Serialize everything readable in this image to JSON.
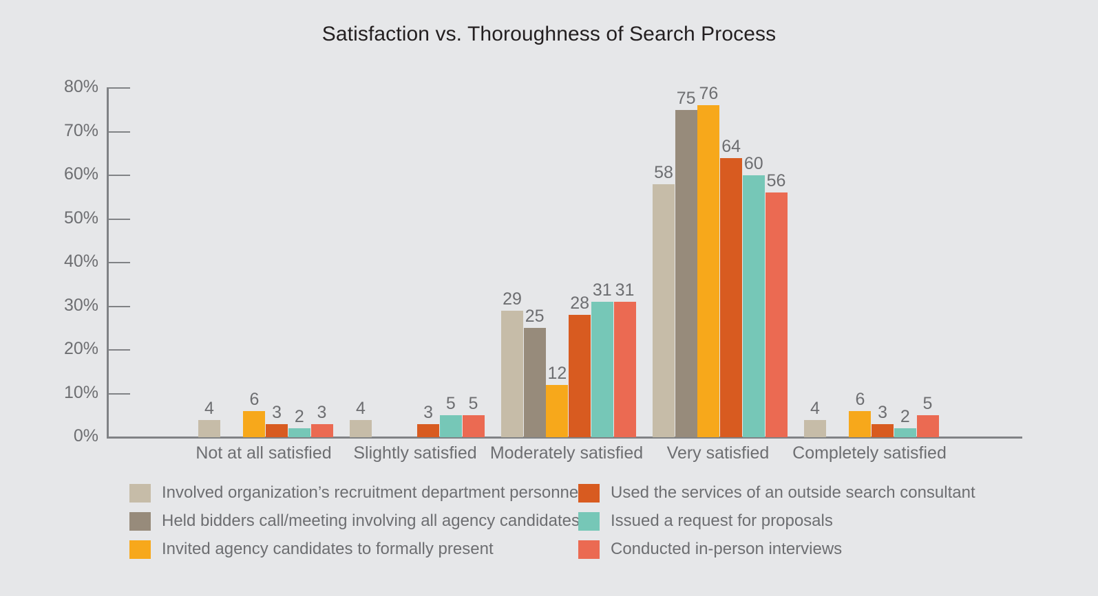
{
  "chart_data": {
    "type": "bar",
    "title": "Satisfaction vs. Thoroughness of Search Process",
    "xlabel": "",
    "ylabel": "",
    "ylim": [
      0,
      80
    ],
    "ytick_labels": [
      "0%",
      "10%",
      "20%",
      "30%",
      "40%",
      "50%",
      "60%",
      "70%",
      "80%"
    ],
    "ytick_values": [
      0,
      10,
      20,
      30,
      40,
      50,
      60,
      70,
      80
    ],
    "grid": false,
    "legend_position": "bottom",
    "value_labels": true,
    "categories": [
      "Not at all satisfied",
      "Slightly satisfied",
      "Moderately satisfied",
      "Very satisfied",
      "Completely satisfied"
    ],
    "series": [
      {
        "name": "Involved organization’s recruitment department personnel",
        "color": "#c6bca8",
        "values": [
          4,
          4,
          29,
          58,
          4
        ]
      },
      {
        "name": "Held bidders call/meeting involving all agency candidates",
        "color": "#978b7b",
        "values": [
          null,
          null,
          25,
          75,
          null
        ]
      },
      {
        "name": "Invited agency candidates to formally present",
        "color": "#f7a81b",
        "values": [
          6,
          null,
          12,
          76,
          6
        ]
      },
      {
        "name": "Used the services of an outside search consultant",
        "color": "#d85b20",
        "values": [
          3,
          3,
          28,
          64,
          3
        ]
      },
      {
        "name": "Issued a request for proposals",
        "color": "#76c7b7",
        "values": [
          2,
          5,
          31,
          60,
          2
        ]
      },
      {
        "name": "Conducted in-person interviews",
        "color": "#eb6a52",
        "values": [
          3,
          5,
          31,
          56,
          5
        ]
      }
    ]
  },
  "colors": {
    "background": "#e6e7e9",
    "axis": "#808285",
    "title_text": "#231f20",
    "label_text": "#6d6e71"
  }
}
